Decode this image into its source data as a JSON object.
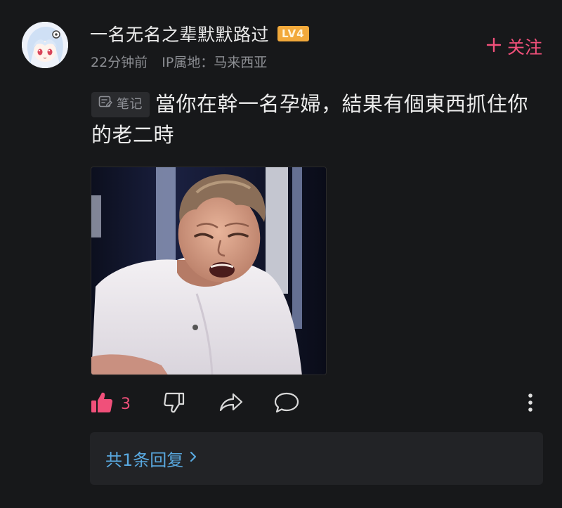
{
  "user": {
    "name": "一名无名之辈默默路过",
    "level": "LV4",
    "time": "22分钟前",
    "ip_location": "IP属地：马来西亚"
  },
  "follow": {
    "label": "关注",
    "icon": "plus-icon"
  },
  "post": {
    "tag_label": "笔记",
    "tag_icon": "note-icon",
    "text": "當你在幹一名孕婦，結果有個東西抓住你的老二時"
  },
  "actions": {
    "like_count": "3",
    "like_icon": "thumbs-up-icon",
    "dislike_icon": "thumbs-down-icon",
    "share_icon": "share-icon",
    "comment_icon": "comment-icon",
    "more_icon": "more-vertical-icon"
  },
  "reply": {
    "label": "共1条回复"
  },
  "colors": {
    "background": "#17181a",
    "accent": "#f0507a",
    "link": "#59a8df",
    "badge": "#f2a93b"
  }
}
